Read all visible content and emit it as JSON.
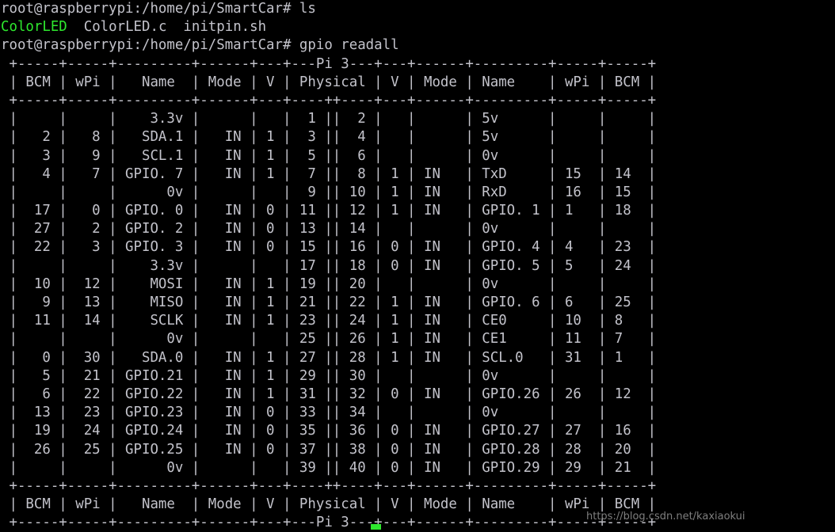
{
  "terminal": {
    "title": "root@raspberrypi: /home/pi/SmartCar",
    "prompt": "root@raspberrypi:/home/pi/SmartCar#",
    "colors": {
      "background": "#000000",
      "foreground": "#c3c3cb",
      "executable_green": "#2ee82e",
      "cursor": "#2ee82e"
    },
    "commands": [
      {
        "prompt": "root@raspberrypi:/home/pi/SmartCar#",
        "command": "ls"
      },
      {
        "prompt": "root@raspberrypi:/home/pi/SmartCar#",
        "command": "gpio readall"
      }
    ],
    "ls_output": [
      {
        "name": "ColorLED",
        "type": "executable",
        "color": "#2ee82e"
      },
      {
        "name": "ColorLED.c",
        "type": "source",
        "color": "#c3c3cb"
      },
      {
        "name": "initpin.sh",
        "type": "script",
        "color": "#c3c3cb"
      }
    ],
    "lines": [
      "root@raspberrypi:/home/pi/SmartCar# ls",
      "__LS__",
      "root@raspberrypi:/home/pi/SmartCar# gpio readall",
      " +-----+-----+---------+------+---+---Pi 3---+---+------+---------+-----+-----+",
      " | BCM | wPi |   Name  | Mode | V | Physical | V | Mode | Name    | wPi | BCM |",
      " +-----+-----+---------+------+---+----++----+---+------+---------+-----+-----+",
      " |     |     |    3.3v |      |   |  1 ||  2 |   |      | 5v      |     |     |",
      " |   2 |   8 |   SDA.1 |   IN | 1 |  3 ||  4 |   |      | 5v      |     |     |",
      " |   3 |   9 |   SCL.1 |   IN | 1 |  5 ||  6 |   |      | 0v      |     |     |",
      " |   4 |   7 | GPIO. 7 |   IN | 1 |  7 ||  8 | 1 | IN   | TxD     | 15  | 14  |",
      " |     |     |      0v |      |   |  9 || 10 | 1 | IN   | RxD     | 16  | 15  |",
      " |  17 |   0 | GPIO. 0 |   IN | 0 | 11 || 12 | 1 | IN   | GPIO. 1 | 1   | 18  |",
      " |  27 |   2 | GPIO. 2 |   IN | 0 | 13 || 14 |   |      | 0v      |     |     |",
      " |  22 |   3 | GPIO. 3 |   IN | 0 | 15 || 16 | 0 | IN   | GPIO. 4 | 4   | 23  |",
      " |     |     |    3.3v |      |   | 17 || 18 | 0 | IN   | GPIO. 5 | 5   | 24  |",
      " |  10 |  12 |    MOSI |   IN | 1 | 19 || 20 |   |      | 0v      |     |     |",
      " |   9 |  13 |    MISO |   IN | 1 | 21 || 22 | 1 | IN   | GPIO. 6 | 6   | 25  |",
      " |  11 |  14 |    SCLK |   IN | 1 | 23 || 24 | 1 | IN   | CE0     | 10  | 8   |",
      " |     |     |      0v |      |   | 25 || 26 | 1 | IN   | CE1     | 11  | 7   |",
      " |   0 |  30 |   SDA.0 |   IN | 1 | 27 || 28 | 1 | IN   | SCL.0   | 31  | 1   |",
      " |   5 |  21 | GPIO.21 |   IN | 1 | 29 || 30 |   |      | 0v      |     |     |",
      " |   6 |  22 | GPIO.22 |   IN | 1 | 31 || 32 | 0 | IN   | GPIO.26 | 26  | 12  |",
      " |  13 |  23 | GPIO.23 |   IN | 0 | 33 || 34 |   |      | 0v      |     |     |",
      " |  19 |  24 | GPIO.24 |   IN | 0 | 35 || 36 | 0 | IN   | GPIO.27 | 27  | 16  |",
      " |  26 |  25 | GPIO.25 |   IN | 0 | 37 || 38 | 0 | IN   | GPIO.28 | 28  | 20  |",
      " |     |     |      0v |      |   | 39 || 40 | 0 | IN   | GPIO.29 | 29  | 21  |",
      " +-----+-----+---------+------+---+----++----+---+------+---------+-----+-----+",
      " | BCM | wPi |   Name  | Mode | V | Physical | V | Mode | Name    | wPi | BCM |",
      " +-----+-----+---------+------+---+---Pi 3---+---+------+---------+-----+-----+"
    ],
    "table": {
      "board": "Pi 3",
      "headers_left": [
        "BCM",
        "wPi",
        "Name",
        "Mode",
        "V"
      ],
      "header_center": "Physical",
      "headers_right": [
        "V",
        "Mode",
        "Name",
        "wPi",
        "BCM"
      ],
      "rows": [
        {
          "bcm_l": "",
          "wpi_l": "",
          "name_l": "3.3v",
          "mode_l": "",
          "v_l": "",
          "phys_l": "1",
          "phys_r": "2",
          "v_r": "",
          "mode_r": "",
          "name_r": "5v",
          "wpi_r": "",
          "bcm_r": ""
        },
        {
          "bcm_l": "2",
          "wpi_l": "8",
          "name_l": "SDA.1",
          "mode_l": "IN",
          "v_l": "1",
          "phys_l": "3",
          "phys_r": "4",
          "v_r": "",
          "mode_r": "",
          "name_r": "5v",
          "wpi_r": "",
          "bcm_r": ""
        },
        {
          "bcm_l": "3",
          "wpi_l": "9",
          "name_l": "SCL.1",
          "mode_l": "IN",
          "v_l": "1",
          "phys_l": "5",
          "phys_r": "6",
          "v_r": "",
          "mode_r": "",
          "name_r": "0v",
          "wpi_r": "",
          "bcm_r": ""
        },
        {
          "bcm_l": "4",
          "wpi_l": "7",
          "name_l": "GPIO. 7",
          "mode_l": "IN",
          "v_l": "1",
          "phys_l": "7",
          "phys_r": "8",
          "v_r": "1",
          "mode_r": "IN",
          "name_r": "TxD",
          "wpi_r": "15",
          "bcm_r": "14"
        },
        {
          "bcm_l": "",
          "wpi_l": "",
          "name_l": "0v",
          "mode_l": "",
          "v_l": "",
          "phys_l": "9",
          "phys_r": "10",
          "v_r": "1",
          "mode_r": "IN",
          "name_r": "RxD",
          "wpi_r": "16",
          "bcm_r": "15"
        },
        {
          "bcm_l": "17",
          "wpi_l": "0",
          "name_l": "GPIO. 0",
          "mode_l": "IN",
          "v_l": "0",
          "phys_l": "11",
          "phys_r": "12",
          "v_r": "1",
          "mode_r": "IN",
          "name_r": "GPIO. 1",
          "wpi_r": "1",
          "bcm_r": "18"
        },
        {
          "bcm_l": "27",
          "wpi_l": "2",
          "name_l": "GPIO. 2",
          "mode_l": "IN",
          "v_l": "0",
          "phys_l": "13",
          "phys_r": "14",
          "v_r": "",
          "mode_r": "",
          "name_r": "0v",
          "wpi_r": "",
          "bcm_r": ""
        },
        {
          "bcm_l": "22",
          "wpi_l": "3",
          "name_l": "GPIO. 3",
          "mode_l": "IN",
          "v_l": "0",
          "phys_l": "15",
          "phys_r": "16",
          "v_r": "0",
          "mode_r": "IN",
          "name_r": "GPIO. 4",
          "wpi_r": "4",
          "bcm_r": "23"
        },
        {
          "bcm_l": "",
          "wpi_l": "",
          "name_l": "3.3v",
          "mode_l": "",
          "v_l": "",
          "phys_l": "17",
          "phys_r": "18",
          "v_r": "0",
          "mode_r": "IN",
          "name_r": "GPIO. 5",
          "wpi_r": "5",
          "bcm_r": "24"
        },
        {
          "bcm_l": "10",
          "wpi_l": "12",
          "name_l": "MOSI",
          "mode_l": "IN",
          "v_l": "1",
          "phys_l": "19",
          "phys_r": "20",
          "v_r": "",
          "mode_r": "",
          "name_r": "0v",
          "wpi_r": "",
          "bcm_r": ""
        },
        {
          "bcm_l": "9",
          "wpi_l": "13",
          "name_l": "MISO",
          "mode_l": "IN",
          "v_l": "1",
          "phys_l": "21",
          "phys_r": "22",
          "v_r": "1",
          "mode_r": "IN",
          "name_r": "GPIO. 6",
          "wpi_r": "6",
          "bcm_r": "25"
        },
        {
          "bcm_l": "11",
          "wpi_l": "14",
          "name_l": "SCLK",
          "mode_l": "IN",
          "v_l": "1",
          "phys_l": "23",
          "phys_r": "24",
          "v_r": "1",
          "mode_r": "IN",
          "name_r": "CE0",
          "wpi_r": "10",
          "bcm_r": "8"
        },
        {
          "bcm_l": "",
          "wpi_l": "",
          "name_l": "0v",
          "mode_l": "",
          "v_l": "",
          "phys_l": "25",
          "phys_r": "26",
          "v_r": "1",
          "mode_r": "IN",
          "name_r": "CE1",
          "wpi_r": "11",
          "bcm_r": "7"
        },
        {
          "bcm_l": "0",
          "wpi_l": "30",
          "name_l": "SDA.0",
          "mode_l": "IN",
          "v_l": "1",
          "phys_l": "27",
          "phys_r": "28",
          "v_r": "1",
          "mode_r": "IN",
          "name_r": "SCL.0",
          "wpi_r": "31",
          "bcm_r": "1"
        },
        {
          "bcm_l": "5",
          "wpi_l": "21",
          "name_l": "GPIO.21",
          "mode_l": "IN",
          "v_l": "1",
          "phys_l": "29",
          "phys_r": "30",
          "v_r": "",
          "mode_r": "",
          "name_r": "0v",
          "wpi_r": "",
          "bcm_r": ""
        },
        {
          "bcm_l": "6",
          "wpi_l": "22",
          "name_l": "GPIO.22",
          "mode_l": "IN",
          "v_l": "1",
          "phys_l": "31",
          "phys_r": "32",
          "v_r": "0",
          "mode_r": "IN",
          "name_r": "GPIO.26",
          "wpi_r": "26",
          "bcm_r": "12"
        },
        {
          "bcm_l": "13",
          "wpi_l": "23",
          "name_l": "GPIO.23",
          "mode_l": "IN",
          "v_l": "0",
          "phys_l": "33",
          "phys_r": "34",
          "v_r": "",
          "mode_r": "",
          "name_r": "0v",
          "wpi_r": "",
          "bcm_r": ""
        },
        {
          "bcm_l": "19",
          "wpi_l": "24",
          "name_l": "GPIO.24",
          "mode_l": "IN",
          "v_l": "0",
          "phys_l": "35",
          "phys_r": "36",
          "v_r": "0",
          "mode_r": "IN",
          "name_r": "GPIO.27",
          "wpi_r": "27",
          "bcm_r": "16"
        },
        {
          "bcm_l": "26",
          "wpi_l": "25",
          "name_l": "GPIO.25",
          "mode_l": "IN",
          "v_l": "0",
          "phys_l": "37",
          "phys_r": "38",
          "v_r": "0",
          "mode_r": "IN",
          "name_r": "GPIO.28",
          "wpi_r": "28",
          "bcm_r": "20"
        },
        {
          "bcm_l": "",
          "wpi_l": "",
          "name_l": "0v",
          "mode_l": "",
          "v_l": "",
          "phys_l": "39",
          "phys_r": "40",
          "v_r": "0",
          "mode_r": "IN",
          "name_r": "GPIO.29",
          "wpi_r": "29",
          "bcm_r": "21"
        }
      ]
    }
  },
  "watermark": {
    "text": "https://blog.csdn.net/kaxiaokui"
  }
}
